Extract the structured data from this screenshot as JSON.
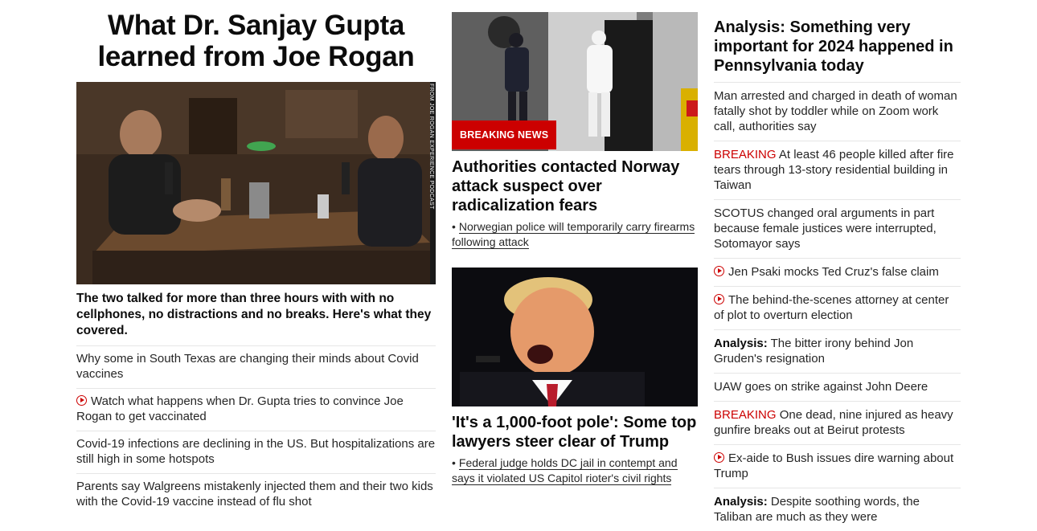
{
  "column1": {
    "headline": "What Dr. Sanjay Gupta learned from Joe Rogan",
    "image_credit": "FROM JOE ROGAN EXPERIENCE PODCAST",
    "description": "The two talked for more than three hours with with no cellphones, no distractions and no breaks. Here's what they covered.",
    "stories": [
      {
        "text": "Why some in South Texas are changing their minds about Covid vaccines",
        "video": false
      },
      {
        "text": "Watch what happens when Dr. Gupta tries to convince Joe Rogan to get vaccinated",
        "video": true
      },
      {
        "text": "Covid-19 infections are declining in the US. But hospitalizations are still high in some hotspots",
        "video": false
      },
      {
        "text": "Parents say Walgreens mistakenly injected them and their two kids with the Covid-19 vaccine instead of flu shot",
        "video": false
      }
    ]
  },
  "column2": {
    "story1": {
      "badge": "BREAKING NEWS",
      "headline": "Authorities contacted Norway attack suspect over radicalization fears",
      "bullet": "•",
      "sublink": "Norwegian police will temporarily carry firearms following attack"
    },
    "story2": {
      "headline": "'It's a 1,000-foot pole': Some top lawyers steer clear of Trump",
      "bullet": "•",
      "sublink": "Federal judge holds DC jail in contempt and says it violated US Capitol rioter's civil rights"
    }
  },
  "column3": {
    "top_analysis": "Analysis: Something very important for 2024 happened in Pennsylvania today",
    "stories": [
      {
        "text": "Man arrested and charged in death of woman fatally shot by toddler while on Zoom work call, authorities say"
      },
      {
        "prefix_breaking": "BREAKING",
        "text": "At least 46 people killed after fire tears through 13-story residential building in Taiwan"
      },
      {
        "text": "SCOTUS changed oral arguments in part because female justices were interrupted, Sotomayor says"
      },
      {
        "video": true,
        "text": "Jen Psaki mocks Ted Cruz's false claim"
      },
      {
        "video": true,
        "text": "The behind-the-scenes attorney at center of plot to overturn election"
      },
      {
        "prefix_bold": "Analysis:",
        "text": "The bitter irony behind Jon Gruden's resignation"
      },
      {
        "text": "UAW goes on strike against John Deere"
      },
      {
        "prefix_breaking": "BREAKING",
        "text": "One dead, nine injured as heavy gunfire breaks out at Beirut protests"
      },
      {
        "video": true,
        "text": "Ex-aide to Bush issues dire warning about Trump"
      },
      {
        "prefix_bold": "Analysis:",
        "text": "Despite soothing words, the Taliban are much as they were"
      }
    ]
  },
  "colors": {
    "accent_red": "#cc0000",
    "divider": "#e6e6e6",
    "text": "#0c0c0c"
  },
  "icons": {
    "video": "play-circle-icon"
  }
}
